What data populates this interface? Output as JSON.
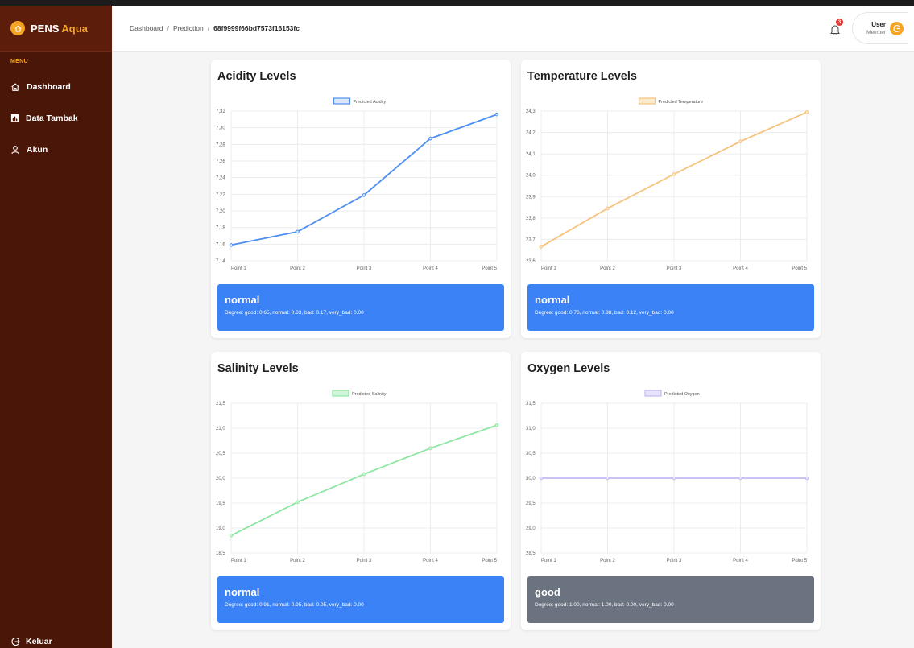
{
  "sidebar": {
    "brand": "PENS",
    "brand_accent": "Aqua",
    "menu_title": "MENU",
    "items": [
      {
        "label": "Dashboard",
        "icon": "home-icon"
      },
      {
        "label": "Data Tambak",
        "icon": "chart-icon"
      },
      {
        "label": "Akun",
        "icon": "user-icon"
      }
    ],
    "logout_label": "Keluar"
  },
  "header": {
    "breadcrumb": [
      "Dashboard",
      "Prediction",
      "68f9999f66bd7573f16153fc"
    ],
    "notification_count": "3",
    "user_name": "User",
    "user_role": "Member"
  },
  "cards": [
    {
      "title": "Acidity Levels",
      "status": "normal",
      "degree": "Degree: good: 0.65, normal: 0.83, bad: 0.17, very_bad: 0.00"
    },
    {
      "title": "Temperature Levels",
      "status": "normal",
      "degree": "Degree: good: 0.76, normal: 0.88, bad: 0.12, very_bad: 0.00"
    },
    {
      "title": "Salinity Levels",
      "status": "normal",
      "degree": "Degree: good: 0.91, normal: 0.95, bad: 0.05, very_bad: 0.00"
    },
    {
      "title": "Oxygen Levels",
      "status": "good",
      "degree": "Degree: good: 1.00, normal: 1.00, bad: 0.00, very_bad: 0.00"
    }
  ],
  "colors": {
    "sidebar_bg": "#4a1608",
    "brand_accent": "#f5a524",
    "status_normal": "#3b82f6",
    "status_good": "#6b7280"
  },
  "chart_data": [
    {
      "type": "line",
      "title": "Acidity Levels",
      "categories": [
        "Point 1",
        "Point 2",
        "Point 3",
        "Point 4",
        "Point 5"
      ],
      "series": [
        {
          "name": "Predicted Acidity",
          "values": [
            7.159,
            7.175,
            7.219,
            7.287,
            7.316
          ],
          "color": "#4f8ff0",
          "fill": "#dbe8fb"
        }
      ],
      "yticks": [
        "7,32",
        "7,30",
        "7,28",
        "7,26",
        "7,24",
        "7,22",
        "7,20",
        "7,18",
        "7,16",
        "7,14"
      ],
      "ylim": [
        7.14,
        7.32
      ],
      "grid": true,
      "legend": "top"
    },
    {
      "type": "line",
      "title": "Temperature Levels",
      "categories": [
        "Point 1",
        "Point 2",
        "Point 3",
        "Point 4",
        "Point 5"
      ],
      "series": [
        {
          "name": "Predicted Temperature",
          "values": [
            23.666,
            23.845,
            24.005,
            24.158,
            24.295
          ],
          "color": "#f6c27c",
          "fill": "#fde9cc"
        }
      ],
      "yticks": [
        "24,3",
        "24,2",
        "24,1",
        "24,0",
        "23,9",
        "23,8",
        "23,7",
        "23,6"
      ],
      "ylim": [
        23.6,
        24.3
      ],
      "grid": true,
      "legend": "top"
    },
    {
      "type": "line",
      "title": "Salinity Levels",
      "categories": [
        "Point 1",
        "Point 2",
        "Point 3",
        "Point 4",
        "Point 5"
      ],
      "series": [
        {
          "name": "Predicted Salinity",
          "values": [
            18.85,
            19.52,
            20.08,
            20.6,
            21.06
          ],
          "color": "#8ee6a3",
          "fill": "#d2f5da"
        }
      ],
      "yticks": [
        "21,5",
        "21,0",
        "20,5",
        "20,0",
        "19,5",
        "19,0",
        "18,5"
      ],
      "ylim": [
        18.5,
        21.5
      ],
      "grid": true,
      "legend": "top"
    },
    {
      "type": "line",
      "title": "Oxygen Levels",
      "categories": [
        "Point 1",
        "Point 2",
        "Point 3",
        "Point 4",
        "Point 5"
      ],
      "series": [
        {
          "name": "Predicted Oxygen",
          "values": [
            30.0,
            30.0,
            30.0,
            30.0,
            30.0
          ],
          "color": "#c3b8f2",
          "fill": "#e9e4fb"
        }
      ],
      "yticks": [
        "31,5",
        "31,0",
        "30,5",
        "30,0",
        "29,5",
        "29,0",
        "28,5"
      ],
      "ylim": [
        28.5,
        31.5
      ],
      "grid": true,
      "legend": "top"
    }
  ]
}
